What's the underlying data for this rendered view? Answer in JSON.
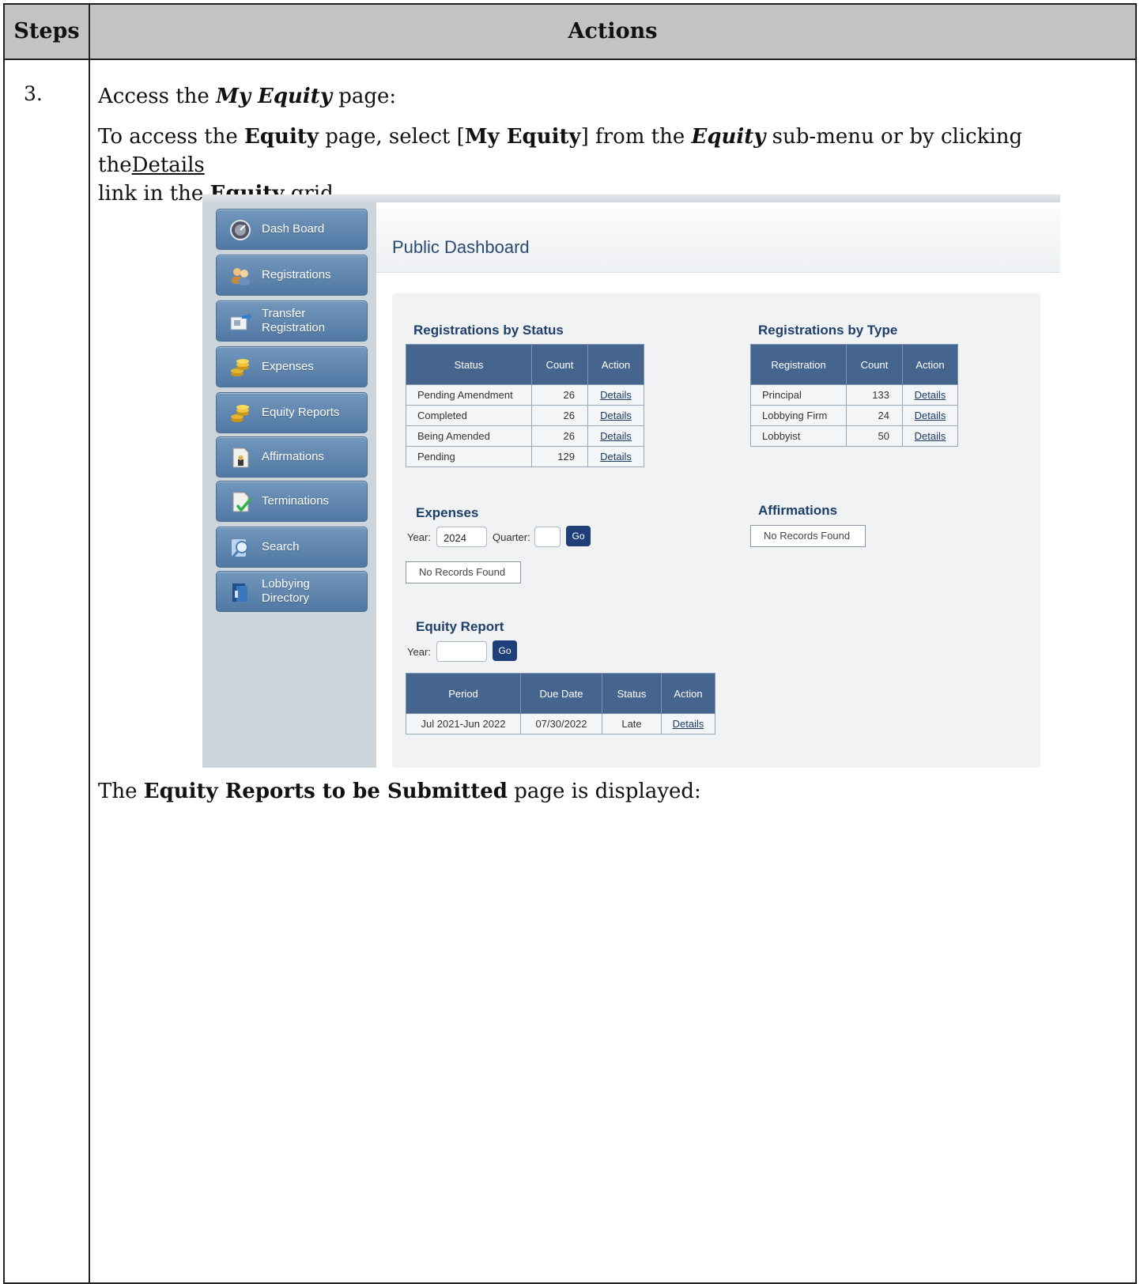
{
  "header": {
    "steps": "Steps",
    "actions": "Actions"
  },
  "step": {
    "number": "3.",
    "p1": {
      "a": "Access the ",
      "b": "My Equity",
      "c": " page:"
    },
    "p2": {
      "a": "To access the ",
      "b": "Equity",
      "c": " page, select [",
      "d": "My Equity",
      "e": "] from the ",
      "f": "Equity",
      "g": " sub-menu or by clicking the",
      "link": "Details",
      "h": " link in the ",
      "i": "Equity",
      "j": " grid."
    },
    "p3": {
      "a": "The ",
      "b": "Equity Reports to be Submitted",
      "c": " page is displayed:"
    }
  },
  "screenshot": {
    "nav": [
      {
        "label": "Dash Board",
        "icon": "dashboard-icon"
      },
      {
        "label": "Registrations",
        "icon": "users-icon"
      },
      {
        "label": "Transfer Registration",
        "icon": "transfer-icon"
      },
      {
        "label": "Expenses",
        "icon": "coins-icon"
      },
      {
        "label": "Equity Reports",
        "icon": "coins-icon"
      },
      {
        "label": "Affirmations",
        "icon": "document-icon"
      },
      {
        "label": "Terminations",
        "icon": "checkmark-document-icon"
      },
      {
        "label": "Search",
        "icon": "search-icon"
      },
      {
        "label": "Lobbying Directory",
        "icon": "directory-icon"
      }
    ],
    "page_title": "Public Dashboard",
    "reg_by_status": {
      "title": "Registrations by Status",
      "headers": [
        "Status",
        "Count",
        "Action"
      ],
      "rows": [
        {
          "status": "Pending Amendment",
          "count": "26",
          "action": "Details"
        },
        {
          "status": "Completed",
          "count": "26",
          "action": "Details"
        },
        {
          "status": "Being Amended",
          "count": "26",
          "action": "Details"
        },
        {
          "status": "Pending",
          "count": "129",
          "action": "Details"
        }
      ]
    },
    "reg_by_type": {
      "title": "Registrations by Type",
      "headers": [
        "Registration",
        "Count",
        "Action"
      ],
      "rows": [
        {
          "type": "Principal",
          "count": "133",
          "action": "Details"
        },
        {
          "type": "Lobbying Firm",
          "count": "24",
          "action": "Details"
        },
        {
          "type": "Lobbyist",
          "count": "50",
          "action": "Details"
        }
      ]
    },
    "expenses": {
      "title": "Expenses",
      "year_label": "Year:",
      "year_value": "2024",
      "quarter_label": "Quarter:",
      "quarter_value": "",
      "go": "Go",
      "no_records": "No Records Found"
    },
    "affirmations": {
      "title": "Affirmations",
      "no_records": "No Records Found"
    },
    "equity_report": {
      "title": "Equity Report",
      "year_label": "Year:",
      "year_value": "",
      "go": "Go",
      "headers": [
        "Period",
        "Due Date",
        "Status",
        "Action"
      ],
      "rows": [
        {
          "period": "Jul 2021-Jun 2022",
          "due": "07/30/2022",
          "status": "Late",
          "action": "Details"
        }
      ]
    }
  }
}
